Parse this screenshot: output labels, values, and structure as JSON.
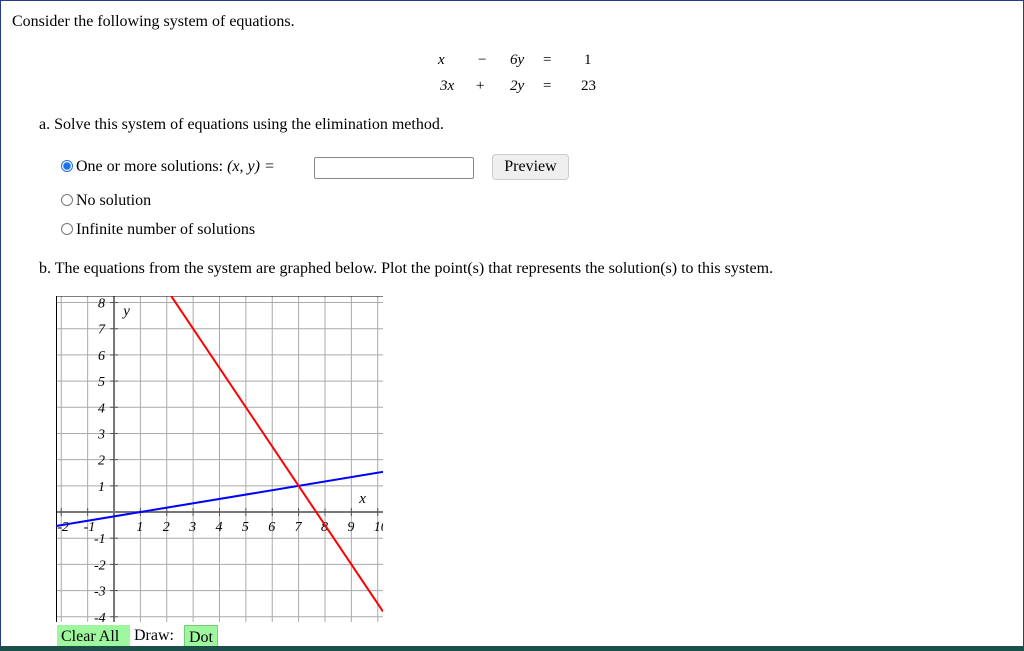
{
  "intro": "Consider the following system of equations.",
  "equations": [
    {
      "a": "x",
      "op": "−",
      "b": "6y",
      "eq": "=",
      "c": "1"
    },
    {
      "a": "3x",
      "op": "+",
      "b": "2y",
      "eq": "=",
      "c": "23"
    }
  ],
  "part_a": {
    "prompt": "a. Solve this system of equations using the elimination method.",
    "options": [
      {
        "label": "One or more solutions: ",
        "math": "(x, y) =",
        "selected": true
      },
      {
        "label": "No solution",
        "selected": false
      },
      {
        "label": "Infinite number of solutions",
        "selected": false
      }
    ],
    "answer_value": "",
    "preview_label": "Preview"
  },
  "part_b": {
    "prompt": "b. The equations from the system are graphed below. Plot the point(s) that represents the solution(s) to this system."
  },
  "graph": {
    "x_label": "x",
    "y_label": "y",
    "xlim": [
      -2.2,
      10.2
    ],
    "ylim": [
      -4.2,
      8.25
    ],
    "x_ticks": [
      -2,
      -1,
      1,
      2,
      3,
      4,
      5,
      6,
      7,
      8,
      9,
      10
    ],
    "y_ticks": [
      -4,
      -3,
      -2,
      -1,
      1,
      2,
      3,
      4,
      5,
      6,
      7,
      8
    ],
    "lines": [
      {
        "equation": "x - 6y = 1",
        "color": "#0000ff",
        "a": 1,
        "b": -6,
        "c": 1
      },
      {
        "equation": "3x + 2y = 23",
        "color": "#ff0000",
        "a": 3,
        "b": 2,
        "c": 23
      }
    ]
  },
  "toolbar": {
    "clear_label": "Clear All",
    "draw_label": "Draw:",
    "dot_label": "Dot"
  }
}
